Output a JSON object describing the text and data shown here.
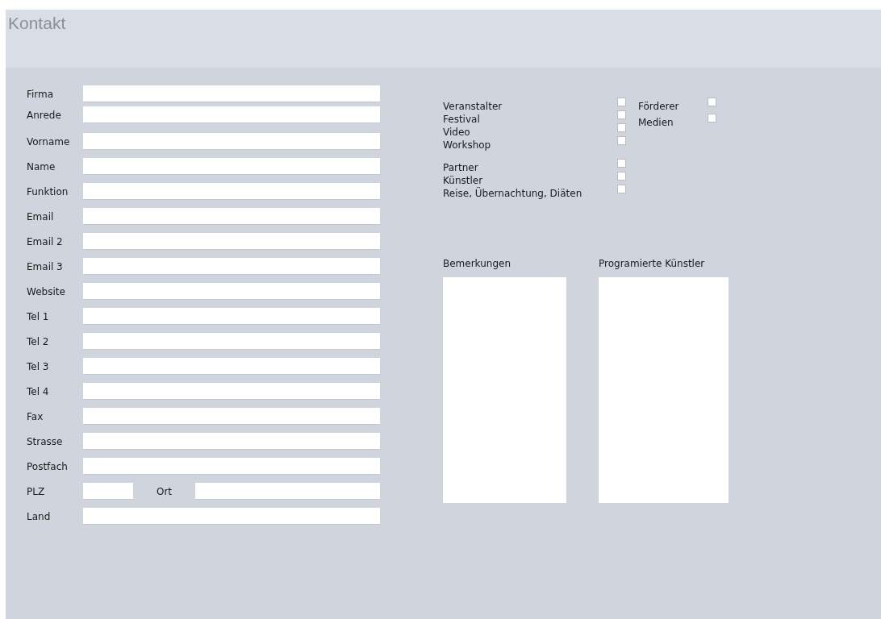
{
  "title": "Kontakt",
  "fields": [
    {
      "kind": "text",
      "label": "Firma"
    },
    {
      "kind": "text",
      "label": "Anrede"
    },
    {
      "kind": "text",
      "label": "Vorname"
    },
    {
      "kind": "text",
      "label": "Name"
    },
    {
      "kind": "text",
      "label": "Funktion"
    },
    {
      "kind": "text",
      "label": "Email"
    },
    {
      "kind": "text",
      "label": "Email 2"
    },
    {
      "kind": "text",
      "label": "Email 3"
    },
    {
      "kind": "text",
      "label": "Website"
    },
    {
      "kind": "text",
      "label": "Tel 1"
    },
    {
      "kind": "text",
      "label": "Tel 2"
    },
    {
      "kind": "text",
      "label": "Tel 3"
    },
    {
      "kind": "text",
      "label": "Tel 4"
    },
    {
      "kind": "text",
      "label": "Fax"
    },
    {
      "kind": "text",
      "label": "Strasse"
    },
    {
      "kind": "text",
      "label": "Postfach"
    },
    {
      "kind": "split",
      "label": "PLZ",
      "second_label": "Ort"
    },
    {
      "kind": "text",
      "label": "Land"
    }
  ],
  "checkbox_groups": [
    [
      {
        "label": "Veranstalter",
        "checked": false
      },
      {
        "label": "Festival",
        "checked": false
      },
      {
        "label": "Video",
        "checked": false
      },
      {
        "label": "Workshop",
        "checked": false
      }
    ],
    [
      {
        "label": "Partner",
        "checked": false
      },
      {
        "label": "Künstler",
        "checked": false
      },
      {
        "label": "Reise, Übernachtung, Diäten",
        "checked": false
      }
    ]
  ],
  "checkboxes_right": [
    {
      "label": "Förderer",
      "checked": false
    },
    {
      "label": "Medien",
      "checked": false
    }
  ],
  "memos": [
    {
      "label": "Bemerkungen"
    },
    {
      "label": "Programierte Künstler"
    }
  ]
}
